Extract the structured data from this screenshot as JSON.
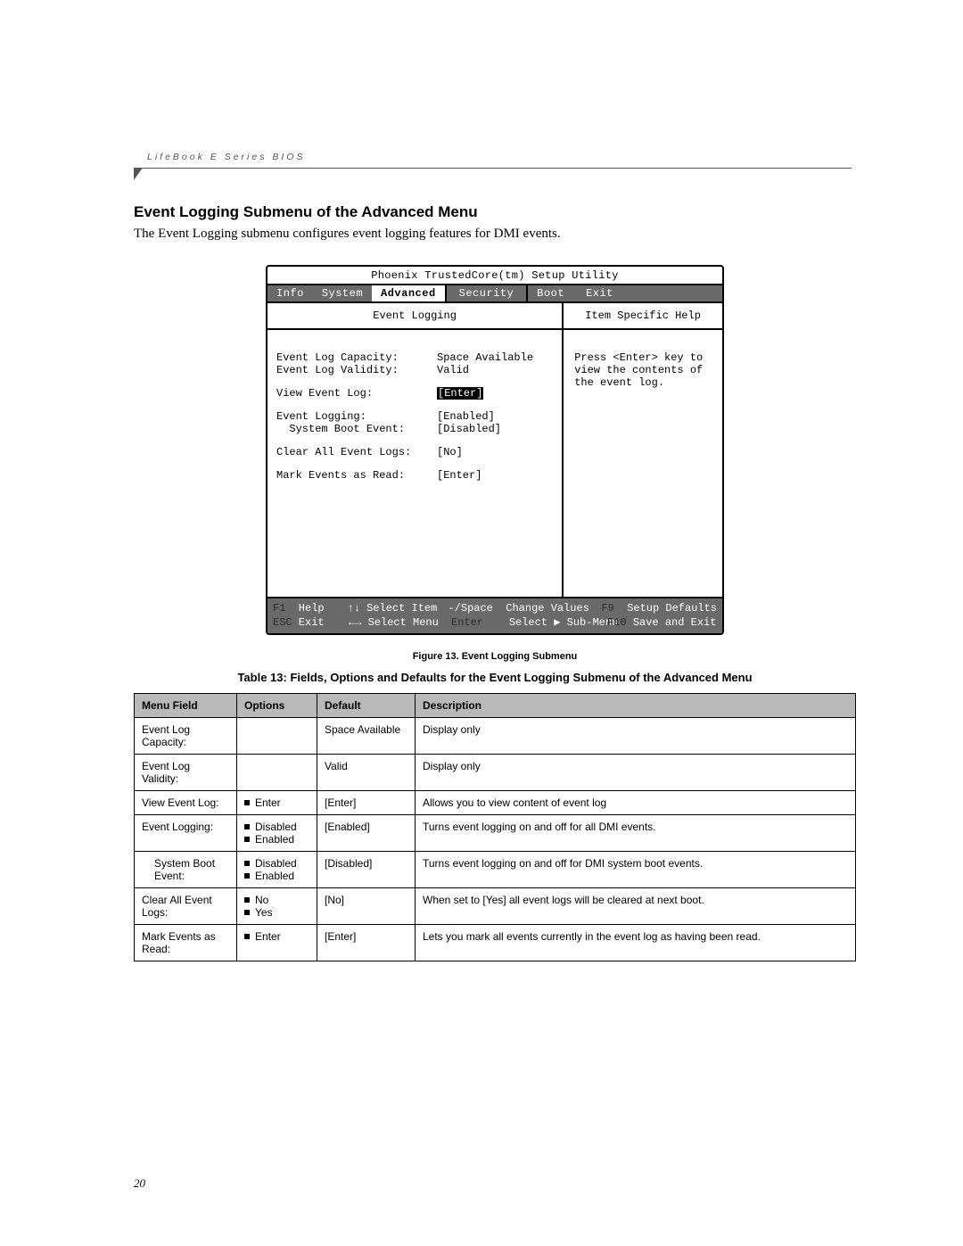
{
  "running_head": "LifeBook E Series BIOS",
  "section_title": "Event Logging Submenu of the Advanced Menu",
  "section_desc": "The Event Logging submenu configures event logging features for DMI events.",
  "bios": {
    "title": "Phoenix TrustedCore(tm) Setup Utility",
    "tabs": {
      "info": "Info",
      "system": "System",
      "advanced": "Advanced",
      "security": "Security",
      "boot": "Boot",
      "exit": "Exit"
    },
    "left_header": "Event Logging",
    "right_header": "Item Specific Help",
    "fields": {
      "capacity": {
        "label": "Event Log Capacity:",
        "value": "Space Available"
      },
      "validity": {
        "label": "Event Log Validity:",
        "value": "Valid"
      },
      "view": {
        "label": "View Event Log:",
        "value": "[Enter]"
      },
      "logging": {
        "label": "Event Logging:",
        "value": "[Enabled]"
      },
      "sysboot": {
        "label": "  System Boot Event:",
        "value": "[Disabled]"
      },
      "clear": {
        "label": "Clear All Event Logs:",
        "value": "[No]"
      },
      "mark": {
        "label": "Mark Events as Read:",
        "value": "[Enter]"
      }
    },
    "help_text_l1": "Press <Enter> key to",
    "help_text_l2": "view the contents of",
    "help_text_l3": "the event log.",
    "footer": {
      "r1c1": "F1  Help",
      "r1c2": "↑↓ Select Item",
      "r1c3": "-/Space  Change Values",
      "r1c4k": "F9  ",
      "r1c4": "Setup Defaults",
      "r2c1": "ESC Exit",
      "r2c2": "←→ Select Menu",
      "r2c3": "Enter    Select ▶ Sub-Menu",
      "r2c4k": "F10 ",
      "r2c4": "Save and Exit"
    }
  },
  "figure_caption": "Figure 13.  Event Logging Submenu",
  "table_caption": "Table 13: Fields, Options and Defaults for the Event Logging Submenu of the Advanced Menu",
  "table": {
    "headers": {
      "field": "Menu Field",
      "options": "Options",
      "default": "Default",
      "desc": "Description"
    },
    "rows": [
      {
        "field": "Event Log Capacity:",
        "indent": false,
        "options": [],
        "default": "Space Available",
        "desc": "Display only"
      },
      {
        "field": "Event Log Validity:",
        "indent": false,
        "options": [],
        "default": "Valid",
        "desc": "Display only"
      },
      {
        "field": "View Event Log:",
        "indent": false,
        "options": [
          "Enter"
        ],
        "default": "[Enter]",
        "desc": "Allows you to view content of event log"
      },
      {
        "field": "Event Logging:",
        "indent": false,
        "options": [
          "Disabled",
          "Enabled"
        ],
        "default": "[Enabled]",
        "desc": "Turns event logging on and off for all DMI events."
      },
      {
        "field": "System Boot Event:",
        "indent": true,
        "options": [
          "Disabled",
          "Enabled"
        ],
        "default": "[Disabled]",
        "desc": "Turns event logging on and off for DMI system boot events."
      },
      {
        "field": "Clear All Event Logs:",
        "indent": false,
        "options": [
          "No",
          "Yes"
        ],
        "default": "[No]",
        "desc": "When set to [Yes] all event logs will be cleared at next boot."
      },
      {
        "field": "Mark Events as Read:",
        "indent": false,
        "options": [
          "Enter"
        ],
        "default": "[Enter]",
        "desc": "Lets you mark all events currently in the event log as having been read."
      }
    ]
  },
  "page_number": "20"
}
